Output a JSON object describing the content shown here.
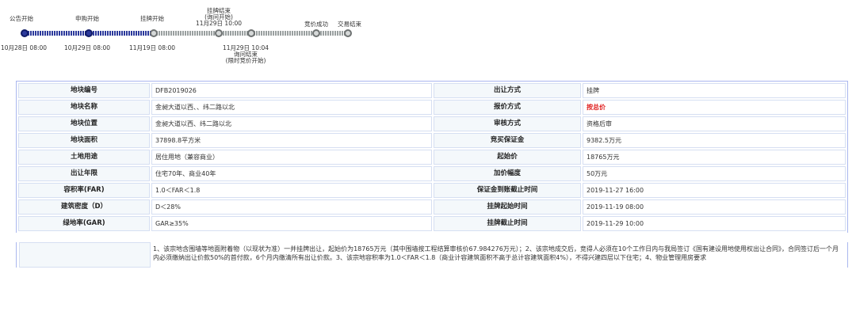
{
  "timeline": {
    "stages": [
      {
        "label": "公告开始",
        "state": "done"
      },
      {
        "label": "申购开始",
        "state": "done"
      },
      {
        "label": "挂牌开始",
        "state": "todo"
      },
      {
        "label": "挂牌结束\n(询问开始)\n11月29日 10:00",
        "state": "todo"
      },
      {
        "label": "",
        "state": "todo"
      },
      {
        "label": "竞价成功",
        "state": "todo"
      },
      {
        "label": "交易结束",
        "state": "todo"
      }
    ],
    "dates": [
      "10月28日 08:00",
      "10月29日 08:00",
      "11月19日 08:00",
      "11月29日 10:04\n询问结束\n(限时竞价开始)"
    ]
  },
  "table": {
    "rows": [
      {
        "k1": "地块编号",
        "v1": "DFB2019026",
        "k2": "出让方式",
        "v2": "挂牌"
      },
      {
        "k1": "地块名称",
        "v1": "金昶大道以西、、纬二路以北",
        "k2": "报价方式",
        "v2": "按总价"
      },
      {
        "k1": "地块位置",
        "v1": "金昶大道以西、纬二路以北",
        "k2": "审核方式",
        "v2": "资格后审"
      },
      {
        "k1": "地块面积",
        "v1": "37898.8平方米",
        "k2": "竞买保证金",
        "v2": "9382.5万元"
      },
      {
        "k1": "土地用途",
        "v1": "居住用地（兼容商业）",
        "k2": "起始价",
        "v2": "18765万元"
      },
      {
        "k1": "出让年限",
        "v1": "住宅70年、商业40年",
        "k2": "加价幅度",
        "v2": "50万元"
      },
      {
        "k1": "容积率(FAR)",
        "v1": "1.0＜FAR＜1.8",
        "k2": "保证金到账截止时间",
        "v2": "2019-11-27 16:00"
      },
      {
        "k1": "建筑密度（D）",
        "v1": "D＜28%",
        "k2": "挂牌起始时间",
        "v2": "2019-11-19 08:00"
      },
      {
        "k1": "绿地率(GAR)",
        "v1": "GAR≥35%",
        "k2": "挂牌截止时间",
        "v2": "2019-11-29 10:00"
      }
    ],
    "note": "1、该宗地含围墙等地面附着物（以现状为准）一并挂牌出让，起始价为18765万元（其中围墙按工程结算审核价67.984276万元）；2、该宗地成交后，竞得人必须在10个工作日内与我局签订《国有建设用地使用权出让合同》，合同签订后一个月内必须缴纳出让价款50%的首付款，6个月内缴清所有出让价款。3、该宗地容积率为1.0＜FAR＜1.8（商业计容建筑面积不高于总计容建筑面积4%），不得兴建四层以下住宅；4、物业管理用房要求",
    "highlight": "#e02020"
  }
}
